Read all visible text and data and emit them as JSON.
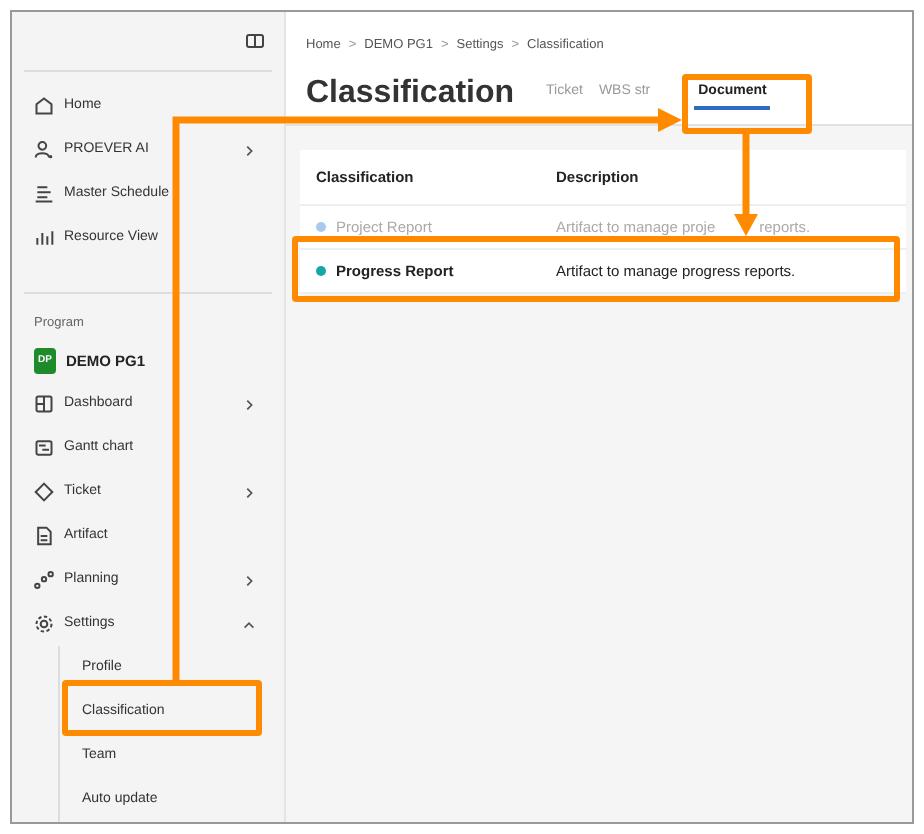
{
  "sidebar": {
    "top_items": [
      {
        "label": "Home",
        "has_children": false
      },
      {
        "label": "PROEVER AI",
        "has_children": true
      },
      {
        "label": "Master Schedule",
        "has_children": false
      },
      {
        "label": "Resource View",
        "has_children": false
      }
    ],
    "section_title": "Program",
    "project": {
      "badge": "DP",
      "name": "DEMO PG1"
    },
    "items": [
      {
        "label": "Dashboard",
        "has_children": true
      },
      {
        "label": "Gantt chart",
        "has_children": false
      },
      {
        "label": "Ticket",
        "has_children": true
      },
      {
        "label": "Artifact",
        "has_children": false
      },
      {
        "label": "Planning",
        "has_children": true
      },
      {
        "label": "Settings",
        "has_children": true,
        "expanded": true,
        "children": [
          {
            "label": "Profile"
          },
          {
            "label": "Classification"
          },
          {
            "label": "Team"
          },
          {
            "label": "Auto update"
          }
        ]
      }
    ]
  },
  "breadcrumb": [
    {
      "kind": "link",
      "text": "Home"
    },
    {
      "kind": "separator",
      "text": ">"
    },
    {
      "kind": "link",
      "text": "DEMO PG1"
    },
    {
      "kind": "separator",
      "text": ">"
    },
    {
      "kind": "link",
      "text": "Settings"
    },
    {
      "kind": "separator",
      "text": ">"
    },
    {
      "kind": "link",
      "text": "Classification"
    }
  ],
  "title": "Classification",
  "tabs": [
    {
      "label": "Ticket",
      "selected": false
    },
    {
      "label": "WBS str",
      "selected": false
    },
    {
      "label": "Document",
      "selected": true
    }
  ],
  "table": {
    "columns": [
      "Classification",
      "Description"
    ],
    "rows": [
      {
        "name": "Project Report",
        "description": "Artifact to manage proje",
        "description_end": "reports.",
        "color": "#a9c9ee",
        "disabled": true
      },
      {
        "name": "Progress Report",
        "description": "Artifact to manage progress reports.",
        "color": "#17a6a6",
        "disabled": false
      }
    ]
  }
}
